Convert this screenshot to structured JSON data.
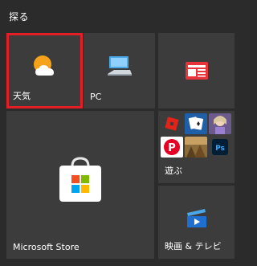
{
  "group": {
    "title": "探る"
  },
  "tiles": {
    "weather": {
      "label": "天気",
      "icon": "weather-sun-cloud-icon",
      "selected": true
    },
    "pc": {
      "label": "PC",
      "icon": "pc-monitor-icon"
    },
    "news": {
      "label": "",
      "icon": "news-icon"
    },
    "store": {
      "label": "Microsoft Store",
      "icon": "store-bag-icon"
    },
    "play": {
      "label": "遊ぶ",
      "apps": [
        {
          "name": "roblox-icon"
        },
        {
          "name": "solitaire-icon"
        },
        {
          "name": "game-character-icon"
        },
        {
          "name": "pinterest-icon"
        },
        {
          "name": "game-scene-icon"
        },
        {
          "name": "photoshop-express-icon"
        }
      ]
    },
    "movies": {
      "label": "映画 & テレビ",
      "icon": "movies-tv-icon"
    }
  },
  "colors": {
    "background": "#2b2b2b",
    "tile": "#3c3c3c",
    "selection": "#e31e24",
    "weather_sun": "#f7a21b",
    "news_red": "#e8353c",
    "pc_blue": "#4aa8e8",
    "movies_blue": "#1f6fd1",
    "pinterest_red": "#e60023",
    "roblox_red": "#e2231a",
    "photoshop_blue": "#31a8ff"
  }
}
